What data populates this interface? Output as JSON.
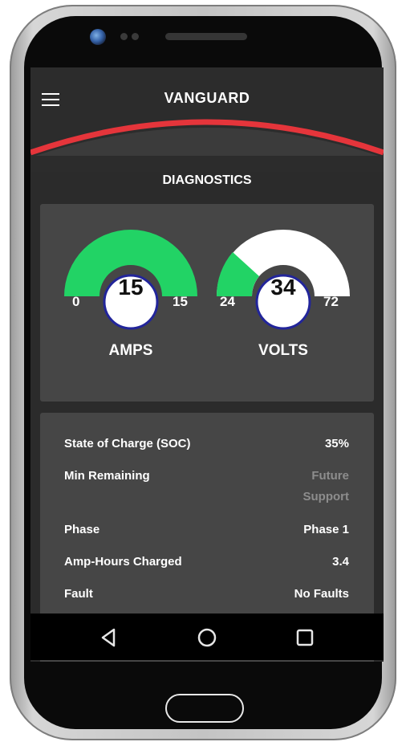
{
  "app": {
    "title": "VANGUARD",
    "section_title": "DIAGNOSTICS"
  },
  "colors": {
    "accent_red": "#e5353b",
    "gauge_green": "#22d365",
    "gauge_track": "#ffffff",
    "value_ring": "#22259a"
  },
  "gauges": {
    "amps": {
      "label": "AMPS",
      "value": "15",
      "min": "0",
      "max": "15",
      "fraction": 1.0
    },
    "volts": {
      "label": "VOLTS",
      "value": "34",
      "min": "24",
      "max": "72",
      "fraction": 0.21
    }
  },
  "diagnostics": [
    {
      "key": "State of Charge (SOC)",
      "value": "35%"
    },
    {
      "key": "Min Remaining",
      "value": "Future Support"
    },
    {
      "key": "Phase",
      "value": "Phase 1"
    },
    {
      "key": "Amp-Hours Charged",
      "value": "3.4"
    },
    {
      "key": "Fault",
      "value": "No Faults"
    }
  ],
  "icons": {
    "menu": "hamburger-menu-icon",
    "back": "back-triangle-icon",
    "home": "home-circle-icon",
    "recents": "recents-square-icon"
  }
}
